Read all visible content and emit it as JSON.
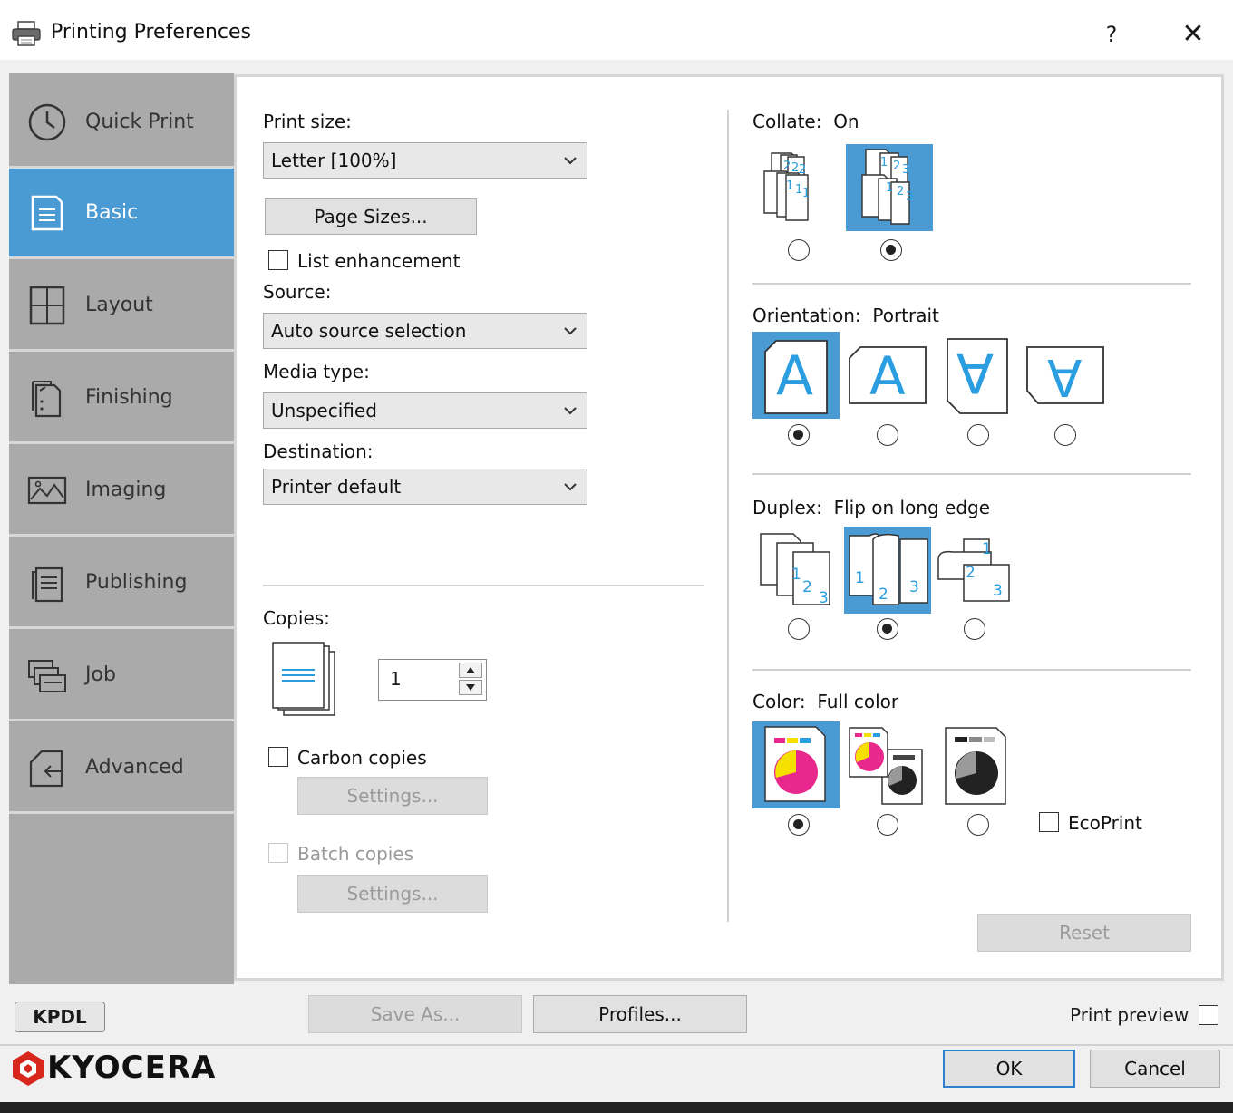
{
  "window": {
    "title": "Printing Preferences",
    "help_label": "?",
    "close_label": "✕"
  },
  "sidebar": {
    "items": [
      {
        "label": "Quick Print",
        "icon": "clock-icon",
        "active": false
      },
      {
        "label": "Basic",
        "icon": "document-icon",
        "active": true
      },
      {
        "label": "Layout",
        "icon": "grid-icon",
        "active": false
      },
      {
        "label": "Finishing",
        "icon": "staple-document-icon",
        "active": false
      },
      {
        "label": "Imaging",
        "icon": "image-icon",
        "active": false
      },
      {
        "label": "Publishing",
        "icon": "pages-icon",
        "active": false
      },
      {
        "label": "Job",
        "icon": "job-stack-icon",
        "active": false
      },
      {
        "label": "Advanced",
        "icon": "advanced-arrow-icon",
        "active": false
      }
    ]
  },
  "basic": {
    "print_size_label": "Print size:",
    "print_size_value": "Letter  [100%]",
    "page_sizes_button": "Page Sizes...",
    "list_enhancement_label": "List enhancement",
    "source_label": "Source:",
    "source_value": "Auto source selection",
    "media_type_label": "Media type:",
    "media_type_value": "Unspecified",
    "destination_label": "Destination:",
    "destination_value": "Printer default",
    "copies_label": "Copies:",
    "copies_value": "1",
    "carbon_copies_label": "Carbon copies",
    "carbon_settings_button": "Settings...",
    "batch_copies_label": "Batch copies",
    "batch_settings_button": "Settings...",
    "collate_label": "Collate:",
    "collate_value": "On",
    "orientation_label": "Orientation:",
    "orientation_value": "Portrait",
    "orientation_glyph": "A",
    "duplex_label": "Duplex:",
    "duplex_value": "Flip on long edge",
    "color_label": "Color:",
    "color_value": "Full color",
    "ecoprint_label": "EcoPrint",
    "reset_button": "Reset"
  },
  "footer": {
    "kpdl_label": "KPDL",
    "save_as_button": "Save As...",
    "profiles_button": "Profiles...",
    "print_preview_label": "Print preview",
    "brand": "KYOCERA",
    "ok_button": "OK",
    "cancel_button": "Cancel"
  },
  "colors": {
    "accent": "#4a9ad4",
    "sidebar": "#aaaaaa",
    "pie_magenta": "#e8288c",
    "pie_yellow": "#f5e000",
    "page_blue": "#2a9ee0",
    "brand_red": "#d7261c"
  }
}
